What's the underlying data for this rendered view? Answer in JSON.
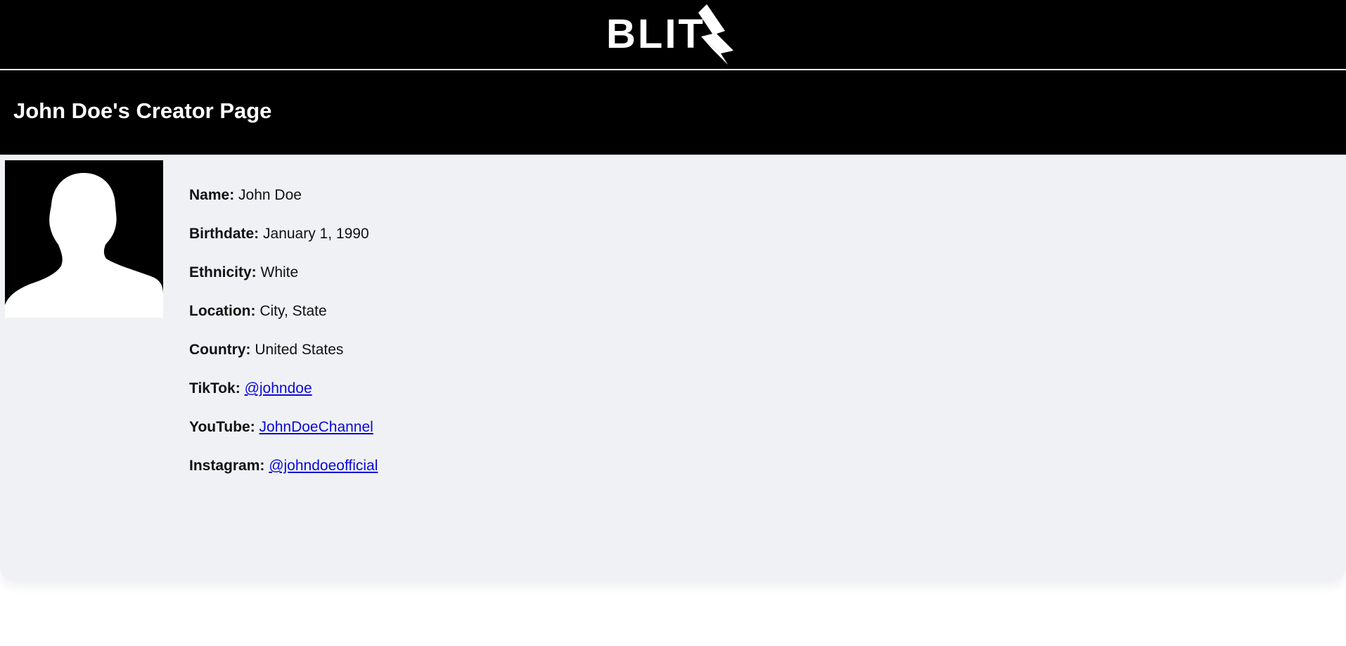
{
  "header": {
    "logo_text": "BLIT",
    "logo_icon": "lightning-bolt-icon"
  },
  "page": {
    "title": "John Doe's Creator Page"
  },
  "profile": {
    "avatar_icon": "person-silhouette-icon",
    "fields": {
      "name": {
        "label": "Name:",
        "value": "John Doe"
      },
      "birthdate": {
        "label": "Birthdate:",
        "value": "January 1, 1990"
      },
      "ethnicity": {
        "label": "Ethnicity:",
        "value": "White"
      },
      "location": {
        "label": "Location:",
        "value": "City, State"
      },
      "country": {
        "label": "Country:",
        "value": "United States"
      },
      "tiktok": {
        "label": "TikTok:",
        "value": "@johndoe"
      },
      "youtube": {
        "label": "YouTube:",
        "value": "JohnDoeChannel"
      },
      "instagram": {
        "label": "Instagram:",
        "value": "@johndoeofficial"
      }
    }
  },
  "colors": {
    "header_bg": "#000000",
    "card_bg": "#f0f1f5",
    "link": "#0a0ad6"
  }
}
